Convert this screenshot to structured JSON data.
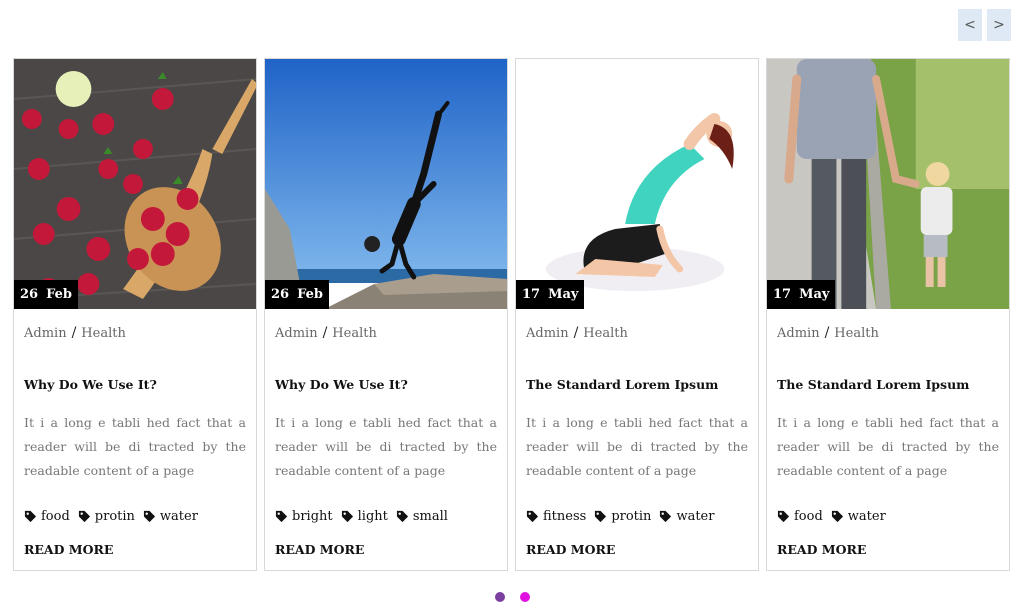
{
  "nav": {
    "prev_label": "<",
    "next_label": ">"
  },
  "cards": [
    {
      "day": "26",
      "month": "Feb",
      "author": "Admin",
      "category": "Health",
      "title": "Why Do We Use It?",
      "excerpt": "It i a long e tabli hed fact that a reader will be di tracted by the readable content of a page",
      "tags": [
        "food",
        "protin",
        "water"
      ],
      "read_more": "READ MORE"
    },
    {
      "day": "26",
      "month": "Feb",
      "author": "Admin",
      "category": "Health",
      "title": "Why Do We Use It?",
      "excerpt": "It i a long e tabli hed fact that a reader will be di tracted by the readable content of a page",
      "tags": [
        "bright",
        "light",
        "small"
      ],
      "read_more": "READ MORE"
    },
    {
      "day": "17",
      "month": "May",
      "author": "Admin",
      "category": "Health",
      "title": "The Standard Lorem Ipsum",
      "excerpt": "It i a long e tabli hed fact that a reader will be di tracted by the readable content of a page",
      "tags": [
        "fitness",
        "protin",
        "water"
      ],
      "read_more": "READ MORE"
    },
    {
      "day": "17",
      "month": "May",
      "author": "Admin",
      "category": "Health",
      "title": "The Standard Lorem Ipsum",
      "excerpt": "It i a long e tabli hed fact that a reader will be di tracted by the readable content of a page",
      "tags": [
        "food",
        "water"
      ],
      "read_more": "READ MORE"
    }
  ],
  "pagination": {
    "colors": {
      "inactive": "#7b3fa0",
      "active": "#e010e0"
    }
  }
}
